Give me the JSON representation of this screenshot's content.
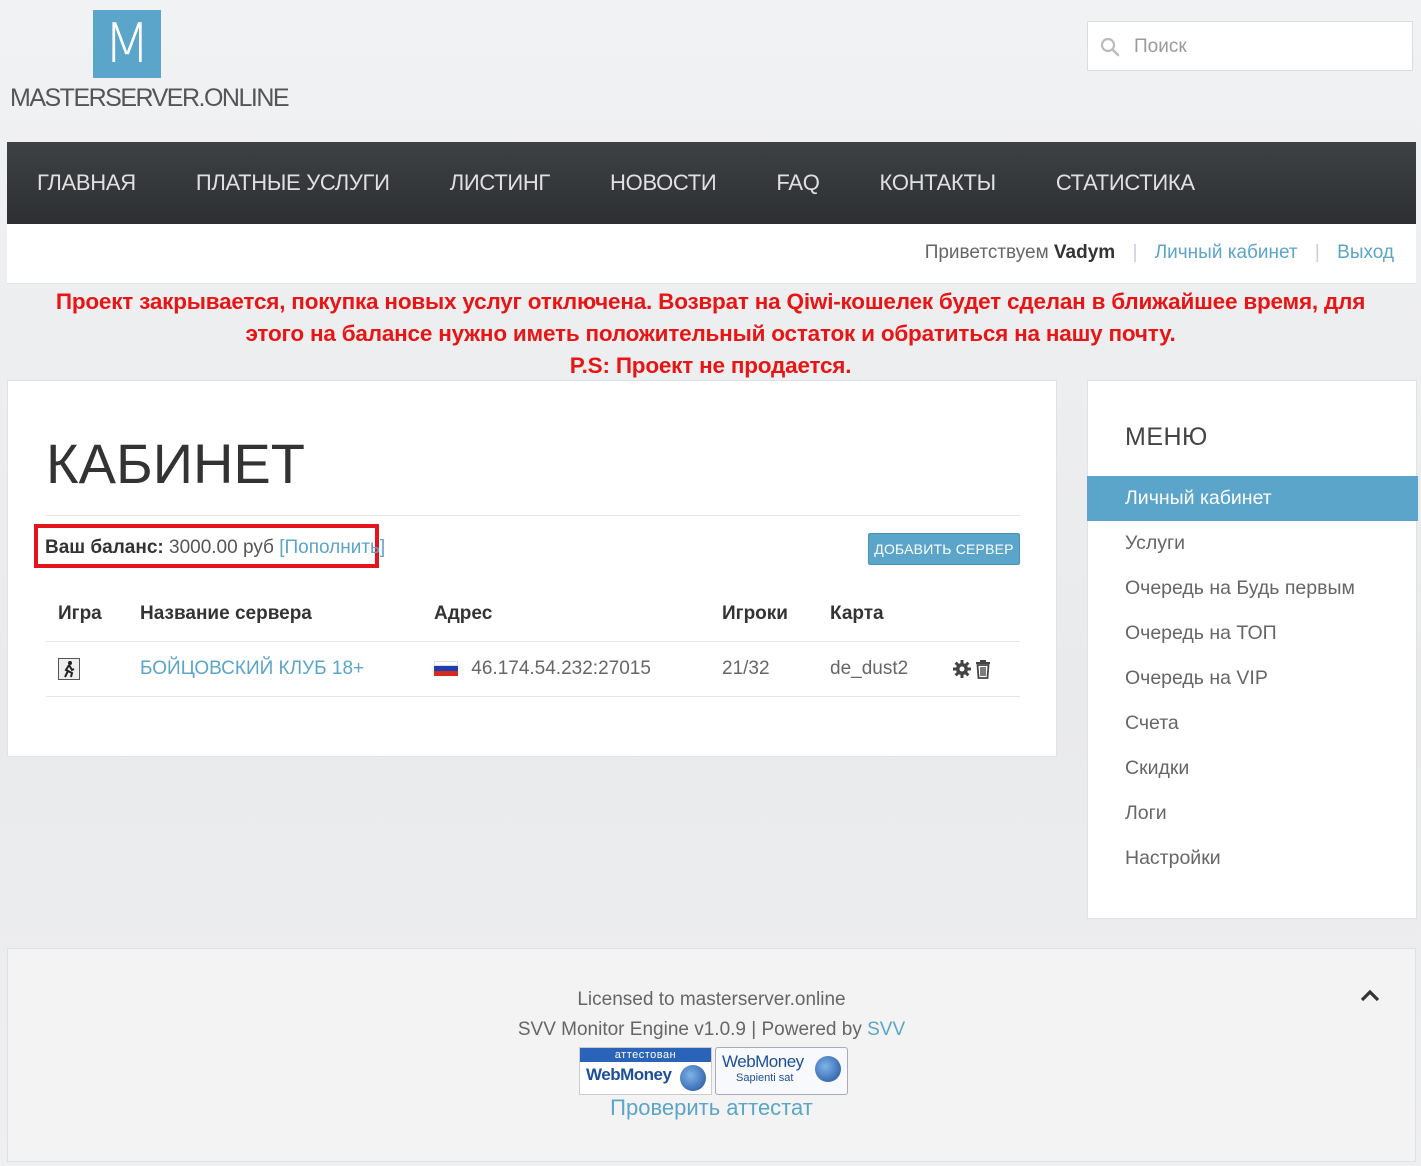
{
  "brand": {
    "logo_letter": "M",
    "name": "MASTERSERVER.ONLINE"
  },
  "search": {
    "placeholder": "Поиск"
  },
  "nav": {
    "items": [
      {
        "label": "ГЛАВНАЯ"
      },
      {
        "label": "ПЛАТНЫЕ УСЛУГИ"
      },
      {
        "label": "ЛИСТИНГ"
      },
      {
        "label": "НОВОСТИ"
      },
      {
        "label": "FAQ"
      },
      {
        "label": "КОНТАКТЫ"
      },
      {
        "label": "СТАТИСТИКА"
      }
    ]
  },
  "user_bar": {
    "greeting": "Приветствуем",
    "username": "Vadym",
    "cabinet_link": "Личный кабинет",
    "logout_link": "Выход"
  },
  "notice": {
    "line1": "Проект закрывается, покупка новых услуг отключена. Возврат на Qiwi-кошелек будет сделан в ближайшее время, для этого на балансе нужно иметь положительный остаток и обратиться на нашу почту.",
    "line2": "P.S: Проект не продается."
  },
  "main": {
    "title": "КАБИНЕТ",
    "balance_label": "Ваш баланс:",
    "balance_value": "3000.00 руб",
    "topup_link": "[Пополнить]",
    "add_server_button": "ДОБАВИТЬ СЕРВЕР",
    "table": {
      "headers": [
        "Игра",
        "Название сервера",
        "Адрес",
        "Игроки",
        "Карта"
      ],
      "rows": [
        {
          "game": "cs-icon",
          "name": "БОЙЦОВСКИЙ КЛУБ 18+",
          "flag": "ru-flag",
          "address": "46.174.54.232:27015",
          "players": "21/32",
          "map": "de_dust2"
        }
      ]
    }
  },
  "sidebar": {
    "title": "МЕНЮ",
    "items": [
      {
        "label": "Личный кабинет",
        "active": true
      },
      {
        "label": "Услуги"
      },
      {
        "label": "Очередь на Будь первым"
      },
      {
        "label": "Очередь на ТОП"
      },
      {
        "label": "Очередь на VIP"
      },
      {
        "label": "Счета"
      },
      {
        "label": "Скидки"
      },
      {
        "label": "Логи"
      },
      {
        "label": "Настройки"
      }
    ]
  },
  "footer": {
    "licensed": "Licensed to masterserver.online",
    "engine": "SVV Monitor Engine v1.0.9 | Powered by",
    "engine_link": "SVV",
    "wm_badge1_top": "аттестован",
    "wm_badge1_text": "WebMoney",
    "wm_badge2_text": "WebMoney",
    "wm_badge2_sub": "Sapienti sat",
    "check_link": "Проверить аттестат"
  },
  "colors": {
    "accent": "#5aa5c9",
    "notice_red": "#e81515",
    "nav_bg": "#35383b",
    "highlight_border": "#e3141b"
  }
}
